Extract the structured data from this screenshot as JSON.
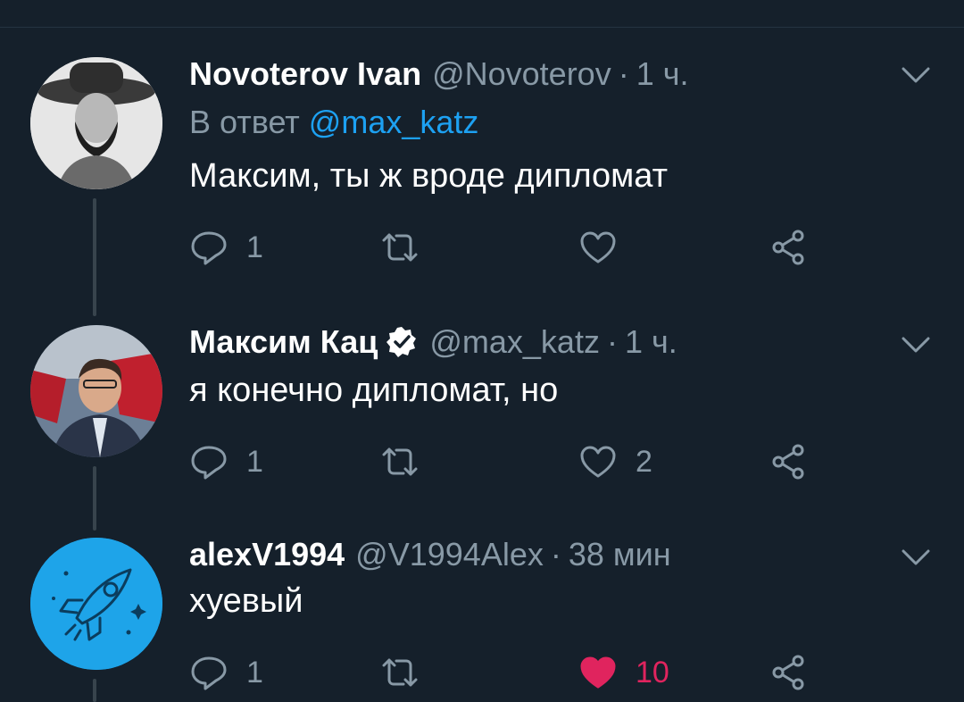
{
  "tweets": [
    {
      "name": "Novoterov Ivan",
      "handle": "@Novoterov",
      "time": "1 ч.",
      "reply_prefix": "В ответ",
      "reply_mention": "@max_katz",
      "text": "Максим, ты ж вроде дипломат",
      "reply_count": "1",
      "retweet_count": "",
      "like_count": "",
      "liked": false
    },
    {
      "name": "Максим Кац",
      "verified": true,
      "handle": "@max_katz",
      "time": "1 ч.",
      "text": "я конечно дипломат, но",
      "reply_count": "1",
      "retweet_count": "",
      "like_count": "2",
      "liked": false
    },
    {
      "name": "alexV1994",
      "handle": "@V1994Alex",
      "time": "38 мин",
      "text": "хуевый",
      "reply_count": "1",
      "retweet_count": "",
      "like_count": "10",
      "liked": true
    }
  ],
  "separator": "·",
  "colors": {
    "background": "#15202b",
    "secondary_text": "#8899a6",
    "accent": "#1da1f2",
    "like_active": "#e0245e",
    "thread_line": "#38444d"
  },
  "icons": [
    "reply-icon",
    "retweet-icon",
    "like-icon",
    "share-icon",
    "chevron-down-icon",
    "verified-badge-icon",
    "rocket-icon"
  ]
}
